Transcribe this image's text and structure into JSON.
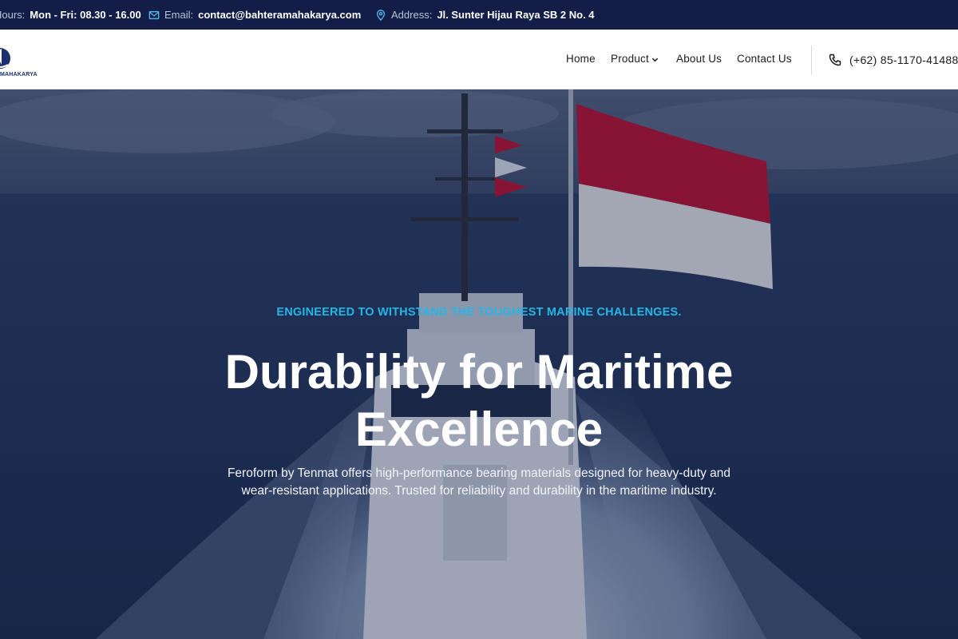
{
  "topbar": {
    "hours_label": "Hours:",
    "hours_value": "Mon - Fri: 08.30 - 16.00",
    "email_label": "Email:",
    "email_value": "contact@bahteramahakarya.com",
    "address_label": "Address:",
    "address_value": "Jl. Sunter Hijau Raya SB 2 No. 4"
  },
  "header": {
    "logo_text": "MAHAKARYA",
    "nav": {
      "home": "Home",
      "product": "Product",
      "about": "About Us",
      "contact": "Contact Us"
    },
    "phone": "(+62) 85-1170-41488"
  },
  "hero": {
    "eyebrow": "ENGINEERED TO WITHSTAND THE TOUGHEST MARINE CHALLENGES.",
    "headline_line1": "Durability for Maritime",
    "headline_line2": "Excellence",
    "description_line1": "Feroform by Tenmat offers high-performance bearing materials designed for heavy-duty and",
    "description_line2": "wear-resistant applications. Trusted for reliability and durability in the maritime industry."
  },
  "colors": {
    "topbar_bg": "#131d47",
    "accent": "#23b6e6",
    "flag_red": "#c8102e",
    "flag_white": "#ffffff"
  }
}
